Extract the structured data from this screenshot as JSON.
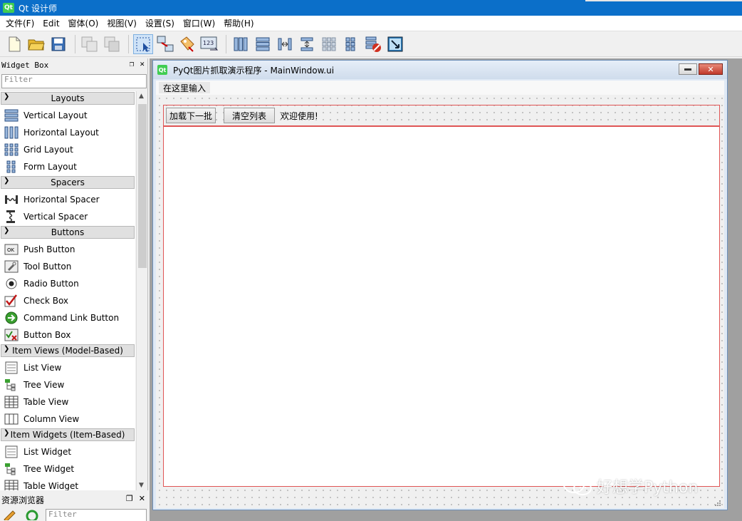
{
  "app": {
    "title": "Qt 设计师",
    "logo": "Qt"
  },
  "menubar": [
    "文件(F)",
    "Edit",
    "窗体(O)",
    "视图(V)",
    "设置(S)",
    "窗口(W)",
    "帮助(H)"
  ],
  "widget_box": {
    "title": "Widget Box",
    "filter_placeholder": "Filter",
    "categories": [
      {
        "label": "Layouts",
        "items": [
          "Vertical Layout",
          "Horizontal Layout",
          "Grid Layout",
          "Form Layout"
        ]
      },
      {
        "label": "Spacers",
        "items": [
          "Horizontal Spacer",
          "Vertical Spacer"
        ]
      },
      {
        "label": "Buttons",
        "items": [
          "Push Button",
          "Tool Button",
          "Radio Button",
          "Check Box",
          "Command Link Button",
          "Button Box"
        ]
      },
      {
        "label": "Item Views (Model-Based)",
        "items": [
          "List View",
          "Tree View",
          "Table View",
          "Column View"
        ]
      },
      {
        "label": "Item Widgets (Item-Based)",
        "items": [
          "List Widget",
          "Tree Widget",
          "Table Widget"
        ]
      }
    ]
  },
  "resource_browser": {
    "title": "资源浏览器",
    "filter_placeholder": "Filter"
  },
  "form_window": {
    "title": "PyQt图片抓取演示程序 - MainWindow.ui",
    "logo": "Qt",
    "menu_placeholder": "在这里输入",
    "buttons": [
      "加载下一批",
      "清空列表"
    ],
    "status_label": "欢迎使用!"
  },
  "watermark": "好想学Python",
  "colors": {
    "titlebar": "#0b6fc9",
    "layout_border": "#e05555",
    "qt_green": "#41cd52"
  }
}
